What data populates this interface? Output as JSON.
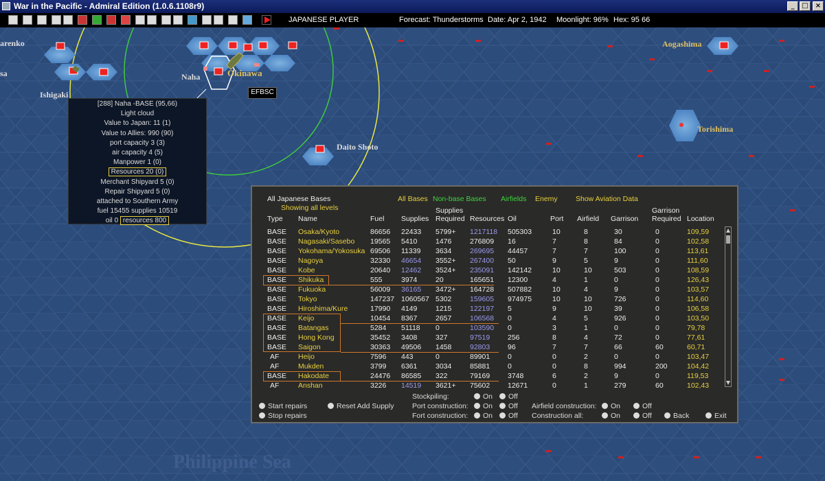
{
  "window": {
    "title": "War in the Pacific - Admiral Edition (1.0.6.1108r9)"
  },
  "statusbar": {
    "player": "JAPANESE PLAYER",
    "forecast": "Forecast: Thunderstorms",
    "date": "Date: Apr 2, 1942",
    "moonlight": "Moonlight: 96%",
    "hex": "Hex: 95 66"
  },
  "map": {
    "labels": {
      "arenko": "arenko",
      "sa": "sa",
      "ishigaki": "Ishigaki",
      "naha": "Naha",
      "okinawa": "Okinawa",
      "daito": "Daito Shoto",
      "aogashima": "Aogashima",
      "torishima": "Torishima",
      "philippine": "Philippine Sea"
    },
    "task_force_tag": "EFBSC"
  },
  "info_box": {
    "lines": [
      "[288] Naha  -BASE (95,66)",
      "Light cloud",
      "Value to Japan: 11 (1)",
      "Value to Allies: 990 (90)",
      "port capacity 3 (3)",
      "air capacity 4 (5)",
      "Manpower  1 (0)",
      "Resources  20 (0)",
      "Merchant Shipyard  5 (0)",
      "Repair Shipyard  5 (0)",
      "attached to Southern Army",
      "fuel 15455 supplies 10519"
    ],
    "oil_prefix": "oil 0",
    "resources_boxed": "resources 800"
  },
  "panel": {
    "title": "All Japanese Bases",
    "subtitle": "Showing all levels",
    "filters": {
      "all_bases": "All Bases",
      "non_base": "Non-base Bases",
      "airfields": "Airfields",
      "enemy": "Enemy",
      "aviation": "Show Aviation Data"
    },
    "headers": {
      "type": "Type",
      "name": "Name",
      "fuel": "Fuel",
      "supplies": "Supplies",
      "supplies_req_top": "Supplies",
      "supplies_req_bottom": "Required",
      "resources": "Resources",
      "oil": "Oil",
      "port": "Port",
      "airfield": "Airfield",
      "garrison": "Garrison",
      "garrison_req_top": "Garrison",
      "garrison_req_bottom": "Required",
      "location": "Location"
    },
    "rows": [
      {
        "type": "BASE",
        "name": "Osaka/Kyoto",
        "fuel": "86656",
        "supplies": "22433",
        "req": "5799+",
        "resources": "1217118",
        "oil": "505303",
        "port": "10",
        "airfield": "8",
        "garrison": "30",
        "greq": "0",
        "loc": "109,59",
        "sb": false,
        "rb": true
      },
      {
        "type": "BASE",
        "name": "Nagasaki/Sasebo",
        "fuel": "19565",
        "supplies": "5410",
        "req": "1476",
        "resources": "276809",
        "oil": "16",
        "port": "7",
        "airfield": "8",
        "garrison": "84",
        "greq": "0",
        "loc": "102,58",
        "sb": false,
        "rb": false
      },
      {
        "type": "BASE",
        "name": "Yokohama/Yokosuka",
        "fuel": "69506",
        "supplies": "11339",
        "req": "3634",
        "resources": "269695",
        "oil": "44457",
        "port": "7",
        "airfield": "7",
        "garrison": "100",
        "greq": "0",
        "loc": "113,61",
        "sb": false,
        "rb": true
      },
      {
        "type": "BASE",
        "name": "Nagoya",
        "fuel": "32330",
        "supplies": "46654",
        "req": "3552+",
        "resources": "267400",
        "oil": "50",
        "port": "9",
        "airfield": "5",
        "garrison": "9",
        "greq": "0",
        "loc": "111,60",
        "sb": true,
        "rb": true
      },
      {
        "type": "BASE",
        "name": "Kobe",
        "fuel": "20640",
        "supplies": "12462",
        "req": "3524+",
        "resources": "235091",
        "oil": "142142",
        "port": "10",
        "airfield": "10",
        "garrison": "503",
        "greq": "0",
        "loc": "108,59",
        "sb": true,
        "rb": true
      },
      {
        "type": "BASE",
        "name": "Shikuka",
        "fuel": "555",
        "supplies": "3974",
        "req": "20",
        "resources": "165651",
        "oil": "12300",
        "port": "4",
        "airfield": "1",
        "garrison": "0",
        "greq": "0",
        "loc": "126,43",
        "sb": false,
        "rb": false
      },
      {
        "type": "BASE",
        "name": "Fukuoka",
        "fuel": "56009",
        "supplies": "36165",
        "req": "3472+",
        "resources": "164728",
        "oil": "507882",
        "port": "10",
        "airfield": "4",
        "garrison": "9",
        "greq": "0",
        "loc": "103,57",
        "sb": true,
        "rb": false
      },
      {
        "type": "BASE",
        "name": "Tokyo",
        "fuel": "147237",
        "supplies": "1060567",
        "req": "5302",
        "resources": "159605",
        "oil": "974975",
        "port": "10",
        "airfield": "10",
        "garrison": "726",
        "greq": "0",
        "loc": "114,60",
        "sb": false,
        "rb": true
      },
      {
        "type": "BASE",
        "name": "Hiroshima/Kure",
        "fuel": "17990",
        "supplies": "4149",
        "req": "1215",
        "resources": "122197",
        "oil": "5",
        "port": "9",
        "airfield": "10",
        "garrison": "39",
        "greq": "0",
        "loc": "106,58",
        "sb": false,
        "rb": true
      },
      {
        "type": "BASE",
        "name": "Keijo",
        "fuel": "10454",
        "supplies": "8367",
        "req": "2657",
        "resources": "106568",
        "oil": "0",
        "port": "4",
        "airfield": "5",
        "garrison": "926",
        "greq": "0",
        "loc": "103,50",
        "sb": false,
        "rb": true
      },
      {
        "type": "BASE",
        "name": "Batangas",
        "fuel": "5284",
        "supplies": "51118",
        "req": "0",
        "resources": "103590",
        "oil": "0",
        "port": "3",
        "airfield": "1",
        "garrison": "0",
        "greq": "0",
        "loc": "79,78",
        "sb": false,
        "rb": true
      },
      {
        "type": "BASE",
        "name": "Hong Kong",
        "fuel": "35452",
        "supplies": "3408",
        "req": "327",
        "resources": "97519",
        "oil": "256",
        "port": "8",
        "airfield": "4",
        "garrison": "72",
        "greq": "0",
        "loc": "77,61",
        "sb": false,
        "rb": true
      },
      {
        "type": "BASE",
        "name": "Saigon",
        "fuel": "30363",
        "supplies": "49506",
        "req": "1458",
        "resources": "92803",
        "oil": "96",
        "port": "7",
        "airfield": "7",
        "garrison": "66",
        "greq": "60",
        "loc": "60,71",
        "sb": false,
        "rb": true
      },
      {
        "type": "AF",
        "name": "Heijo",
        "fuel": "7596",
        "supplies": "443",
        "req": "0",
        "resources": "89901",
        "oil": "0",
        "port": "0",
        "airfield": "2",
        "garrison": "0",
        "greq": "0",
        "loc": "103,47",
        "sb": false,
        "rb": false
      },
      {
        "type": "AF",
        "name": "Mukden",
        "fuel": "3799",
        "supplies": "6361",
        "req": "3034",
        "resources": "85881",
        "oil": "0",
        "port": "0",
        "airfield": "8",
        "garrison": "994",
        "greq": "200",
        "loc": "104,42",
        "sb": false,
        "rb": false
      },
      {
        "type": "BASE",
        "name": "Hakodate",
        "fuel": "24476",
        "supplies": "86585",
        "req": "322",
        "resources": "79169",
        "oil": "3748",
        "port": "6",
        "airfield": "2",
        "garrison": "9",
        "greq": "0",
        "loc": "119,53",
        "sb": false,
        "rb": false
      },
      {
        "type": "AF",
        "name": "Anshan",
        "fuel": "3226",
        "supplies": "14519",
        "req": "3621+",
        "resources": "75602",
        "oil": "12671",
        "port": "0",
        "airfield": "1",
        "garrison": "279",
        "greq": "60",
        "loc": "102,43",
        "sb": true,
        "rb": false
      }
    ],
    "controls": {
      "start_repairs": "Start repairs",
      "stop_repairs": "Stop repairs",
      "reset_supply": "Reset Add Supply",
      "stockpiling": "Stockpiling:",
      "port_construction": "Port construction:",
      "fort_construction": "Fort construction:",
      "airfield_construction": "Airfield construction:",
      "construction_all": "Construction all:",
      "on": "On",
      "off": "Off",
      "back": "Back",
      "exit": "Exit"
    }
  }
}
